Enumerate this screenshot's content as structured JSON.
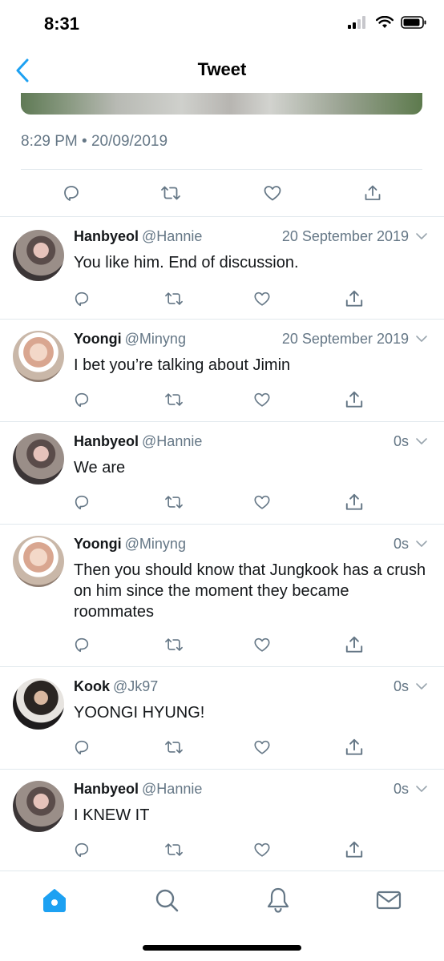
{
  "status": {
    "time": "8:31"
  },
  "nav": {
    "title": "Tweet"
  },
  "main_tweet": {
    "timestamp": "8:29 PM • 20/09/2019"
  },
  "replies": [
    {
      "name": "Hanbyeol",
      "handle": "@Hannie",
      "time": "20 September 2019",
      "text": "You like him. End of discussion."
    },
    {
      "name": "Yoongi",
      "handle": "@Minyng",
      "time": "20 September 2019",
      "text": "I bet you’re talking about Jimin"
    },
    {
      "name": "Hanbyeol",
      "handle": "@Hannie",
      "time": "0s",
      "text": "We are"
    },
    {
      "name": "Yoongi",
      "handle": "@Minyng",
      "time": "0s",
      "text": "Then you should know that Jungkook has a crush on him since the moment they became roommates"
    },
    {
      "name": "Kook",
      "handle": "@Jk97",
      "time": "0s",
      "text": "YOONGI HYUNG!"
    },
    {
      "name": "Hanbyeol",
      "handle": "@Hannie",
      "time": "0s",
      "text": "I KNEW IT"
    }
  ],
  "colors": {
    "accent": "#1da1f2",
    "icon_gray": "#657786",
    "divider": "#e1e8ed"
  },
  "icons": {
    "tweet_actions": [
      "reply-icon",
      "retweet-icon",
      "like-icon",
      "share-icon"
    ],
    "tabs": [
      "home-icon",
      "search-icon",
      "notifications-icon",
      "messages-icon"
    ]
  }
}
